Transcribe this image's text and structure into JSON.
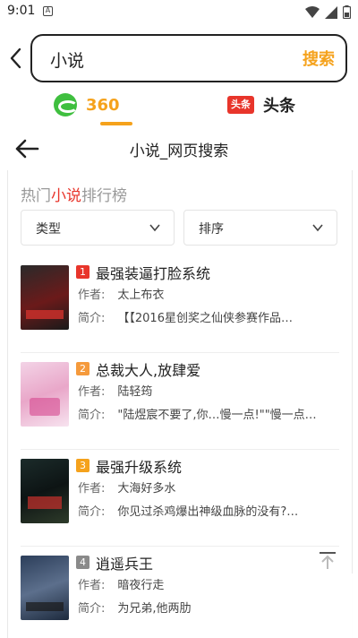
{
  "status_bar": {
    "time": "9:01",
    "sim_glyph": "A"
  },
  "search": {
    "query": "小说",
    "button_label": "搜索"
  },
  "engines": [
    {
      "label": "360",
      "active": true
    },
    {
      "logo_text": "头条",
      "label": "头条",
      "active": false
    }
  ],
  "page": {
    "title": "小说_网页搜索"
  },
  "ranking": {
    "heading_pre": "热门",
    "heading_hl": "小说",
    "heading_post": "排行榜",
    "filters": [
      "类型",
      "排序"
    ],
    "books": [
      {
        "rank": "1",
        "rank_color": "#e8352b",
        "title": "最强装逼打脸系统",
        "author_key": "作者:",
        "author": "太上布衣",
        "intro_key": "简介:",
        "intro": "【【2016星创奖之仙侠参赛作品…",
        "cover": "cover-dark-red"
      },
      {
        "rank": "2",
        "rank_color": "#f59a3c",
        "title": "总裁大人,放肆爱",
        "author_key": "作者:",
        "author": "陆轻筠",
        "intro_key": "简介:",
        "intro": "\"陆煜宸不要了,你…慢一点!\"\"慢一点…",
        "cover": "cover-pink"
      },
      {
        "rank": "3",
        "rank_color": "#f5a21c",
        "title": "最强升级系统",
        "author_key": "作者:",
        "author": "大海好多水",
        "intro_key": "简介:",
        "intro": "你见过杀鸡爆出神级血脉的没有?…",
        "cover": "cover-dark-green"
      },
      {
        "rank": "4",
        "rank_color": "#8a8a8a",
        "title": "逍遥兵王",
        "author_key": "作者:",
        "author": "暗夜行走",
        "intro_key": "简介:",
        "intro": "为兄弟,他两肋",
        "cover": "cover-blue"
      }
    ]
  },
  "icons": {
    "back": "chevron-left-icon",
    "arrow_back": "arrow-left-icon",
    "filter_chevron": "chevron-down-icon",
    "scroll_top": "scroll-to-top-icon"
  }
}
